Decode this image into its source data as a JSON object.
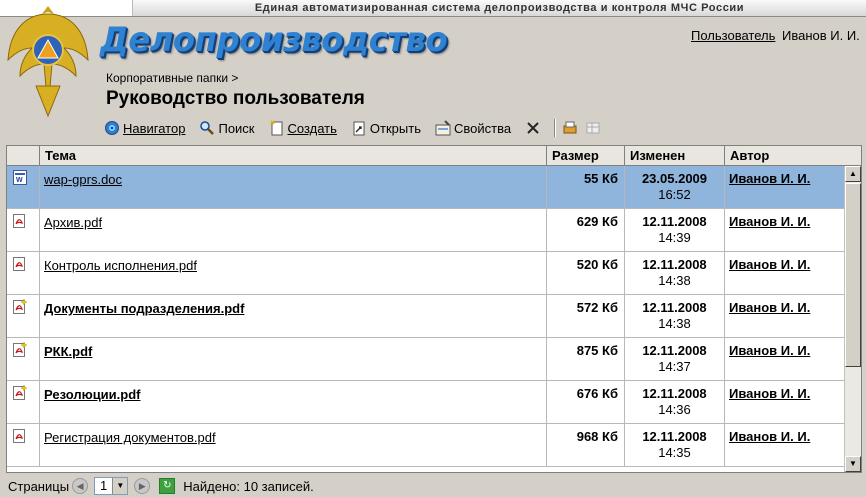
{
  "header": {
    "system_title": "Единая автоматизированная система делопроизводства и контроля МЧС России",
    "brand": "Делопроизводство",
    "user_label": "Пользователь",
    "user_name": "Иванов И. И."
  },
  "breadcrumb": "Корпоративные папки >",
  "page_title": "Руководство пользователя",
  "toolbar": {
    "navigator": "Навигатор",
    "search": "Поиск",
    "create": "Создать",
    "open": "Открыть",
    "properties": "Свойства",
    "delete_icon": "close-icon"
  },
  "table": {
    "columns": [
      "Тема",
      "Размер",
      "Изменен",
      "Автор"
    ],
    "rows": [
      {
        "icon": "word-doc-icon",
        "name": "wap-gprs.doc",
        "size": "55 Кб",
        "date": "23.05.2009",
        "time": "16:52",
        "author": "Иванов И. И.",
        "bold": false,
        "selected": true
      },
      {
        "icon": "pdf-icon",
        "name": "Архив.pdf",
        "size": "629 Кб",
        "date": "12.11.2008",
        "time": "14:39",
        "author": "Иванов И. И.",
        "bold": false,
        "selected": false
      },
      {
        "icon": "pdf-icon",
        "name": "Контроль исполнения.pdf",
        "size": "520 Кб",
        "date": "12.11.2008",
        "time": "14:38",
        "author": "Иванов И. И.",
        "bold": false,
        "selected": false
      },
      {
        "icon": "pdf-new-icon",
        "name": "Документы подразделения.pdf",
        "size": "572 Кб",
        "date": "12.11.2008",
        "time": "14:38",
        "author": "Иванов И. И.",
        "bold": true,
        "selected": false
      },
      {
        "icon": "pdf-new-icon",
        "name": "РКК.pdf",
        "size": "875 Кб",
        "date": "12.11.2008",
        "time": "14:37",
        "author": "Иванов И. И.",
        "bold": true,
        "selected": false
      },
      {
        "icon": "pdf-new-icon",
        "name": "Резолюции.pdf",
        "size": "676 Кб",
        "date": "12.11.2008",
        "time": "14:36",
        "author": "Иванов И. И.",
        "bold": true,
        "selected": false
      },
      {
        "icon": "pdf-icon",
        "name": "Регистрация документов.pdf",
        "size": "968 Кб",
        "date": "12.11.2008",
        "time": "14:35",
        "author": "Иванов И. И.",
        "bold": false,
        "selected": false
      }
    ]
  },
  "footer": {
    "pages_label": "Страницы",
    "page_value": "1",
    "found_text": "Найдено: 10 записей."
  }
}
